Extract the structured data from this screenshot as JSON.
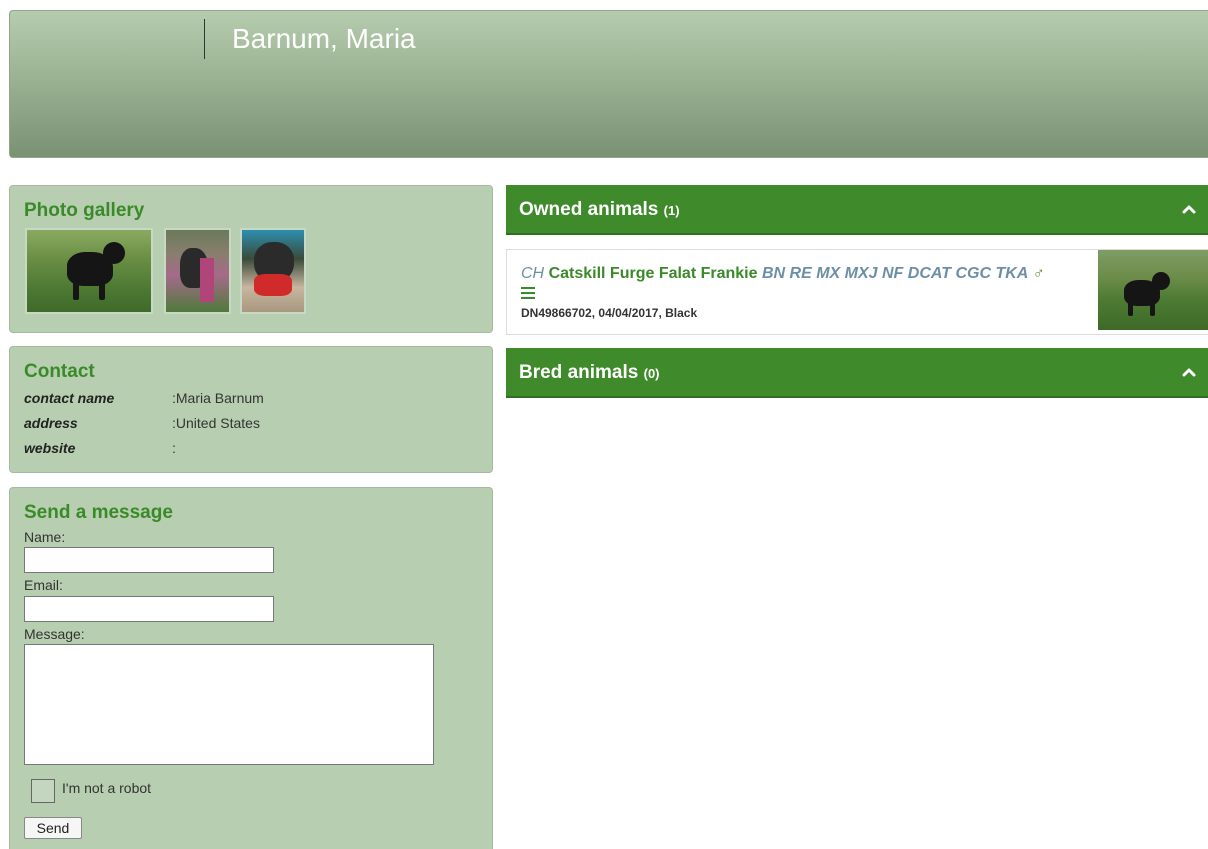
{
  "header": {
    "title": "Barnum, Maria"
  },
  "gallery": {
    "title": "Photo gallery",
    "photos": [
      "dog-photo-1",
      "dog-photo-2",
      "dog-photo-3"
    ]
  },
  "contact": {
    "title": "Contact",
    "rows": [
      {
        "key": "contact name",
        "value": ":Maria Barnum"
      },
      {
        "key": "address",
        "value": ":United States"
      },
      {
        "key": "website",
        "value": ":"
      }
    ]
  },
  "message": {
    "title": "Send a message",
    "name_label": "Name:",
    "name_value": "",
    "email_label": "Email:",
    "email_value": "",
    "message_label": "Message:",
    "message_value": "",
    "robot_label": "I'm not a robot",
    "send_label": "Send"
  },
  "owned": {
    "title": "Owned animals",
    "count": "(1)",
    "animals": [
      {
        "prefix": "CH",
        "name": "Catskill Furge Falat Frankie",
        "suffix": "BN RE MX MXJ NF DCAT CGC TKA",
        "sex_symbol": "♂",
        "meta": "DN49866702, 04/04/2017, Black"
      }
    ]
  },
  "bred": {
    "title": "Bred animals",
    "count": "(0)"
  },
  "colors": {
    "accent_green": "#3f8a2b",
    "panel_bg": "#b7cfb0",
    "title_green": "#3b8a2a",
    "titles_blue": "#6b8fa6"
  }
}
